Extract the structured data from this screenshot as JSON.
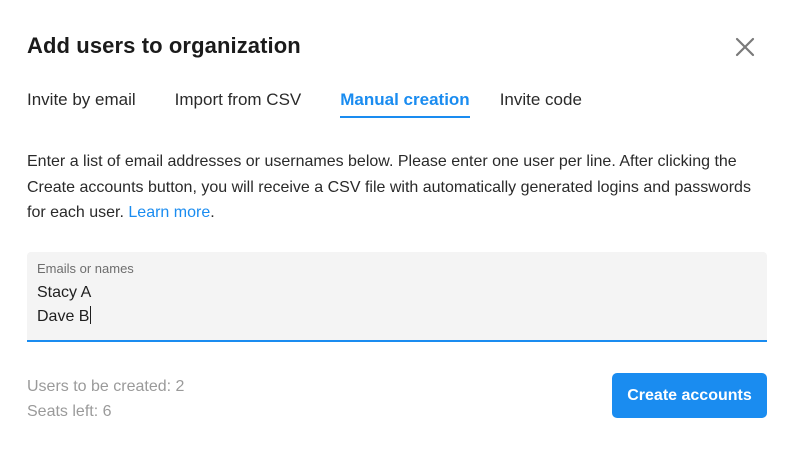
{
  "dialog": {
    "title": "Add users to organization",
    "close_icon": "close-icon"
  },
  "tabs": [
    {
      "label": "Invite by email",
      "active": false
    },
    {
      "label": "Import from CSV",
      "active": false
    },
    {
      "label": "Manual creation",
      "active": true
    },
    {
      "label": "Invite code",
      "active": false
    }
  ],
  "description": {
    "text": "Enter a list of email addresses or usernames below. Please enter one user per line. After clicking the Create accounts button, you will receive a CSV file with automatically generated logins and passwords for each user.",
    "link_text": "Learn more",
    "suffix": "."
  },
  "field": {
    "label": "Emails or names",
    "lines": [
      "Stacy A",
      "Dave B"
    ]
  },
  "stats": {
    "users_to_create": "Users to be created: 2",
    "seats_left": "Seats left: 6"
  },
  "actions": {
    "create_label": "Create accounts"
  },
  "colors": {
    "accent": "#1a8cf0",
    "field_bg": "#f4f4f4",
    "muted_text": "#9a9a9a"
  }
}
